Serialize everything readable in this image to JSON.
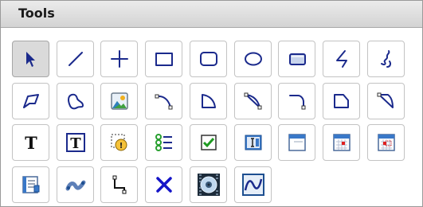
{
  "panel": {
    "title": "Tools"
  },
  "colors": {
    "stroke": "#1b2a8c",
    "panel_header": "#d9d9d9",
    "selected": "#dadada",
    "delete": "#1515c8"
  },
  "tools": [
    {
      "name": "pointer-tool-button",
      "icon": "pointer-icon",
      "selected": true
    },
    {
      "name": "line-tool-button",
      "icon": "line-icon"
    },
    {
      "name": "crosshair-tool-button",
      "icon": "plus-icon"
    },
    {
      "name": "rectangle-tool-button",
      "icon": "rectangle-icon"
    },
    {
      "name": "rounded-rectangle-tool-button",
      "icon": "rounded-rectangle-icon"
    },
    {
      "name": "ellipse-tool-button",
      "icon": "ellipse-icon"
    },
    {
      "name": "shaded-rectangle-tool-button",
      "icon": "shaded-rectangle-icon"
    },
    {
      "name": "zigzag-line-tool-button",
      "icon": "zigzag-icon"
    },
    {
      "name": "freehand-tool-button",
      "icon": "freehand-icon"
    },
    {
      "name": "polygon-tool-button",
      "icon": "polygon-icon"
    },
    {
      "name": "closed-curve-tool-button",
      "icon": "closed-curve-icon"
    },
    {
      "name": "image-tool-button",
      "icon": "image-icon"
    },
    {
      "name": "arc-tool-button",
      "icon": "arc-icon"
    },
    {
      "name": "chord-tool-button",
      "icon": "chord-icon"
    },
    {
      "name": "pie-tool-button",
      "icon": "pie-icon"
    },
    {
      "name": "arc-corner-tool-button",
      "icon": "arc-corner-icon"
    },
    {
      "name": "chord-corner-tool-button",
      "icon": "chord-corner-icon"
    },
    {
      "name": "pie-corner-tool-button",
      "icon": "pie-corner-icon"
    },
    {
      "name": "text-tool-button",
      "icon": "text-icon",
      "glyph": "T"
    },
    {
      "name": "text-box-tool-button",
      "icon": "text-box-icon",
      "glyph": "T"
    },
    {
      "name": "alarm-object-tool-button",
      "icon": "alarm-icon"
    },
    {
      "name": "list-tool-button",
      "icon": "list-icon"
    },
    {
      "name": "checkbox-tool-button",
      "icon": "checkbox-icon"
    },
    {
      "name": "numeric-input-tool-button",
      "icon": "numeric-input-icon"
    },
    {
      "name": "window-tool-button",
      "icon": "window-icon"
    },
    {
      "name": "calendar-tool-button",
      "icon": "calendar-icon"
    },
    {
      "name": "calendar-highlight-tool-button",
      "icon": "calendar-highlight-icon"
    },
    {
      "name": "report-tool-button",
      "icon": "report-icon"
    },
    {
      "name": "trend-pen-tool-button",
      "icon": "trend-icon"
    },
    {
      "name": "connector-tool-button",
      "icon": "connector-icon"
    },
    {
      "name": "delete-tool-button",
      "icon": "delete-x-icon"
    },
    {
      "name": "media-player-tool-button",
      "icon": "media-icon"
    },
    {
      "name": "trend-chart-tool-button",
      "icon": "trend-chart-icon"
    }
  ]
}
